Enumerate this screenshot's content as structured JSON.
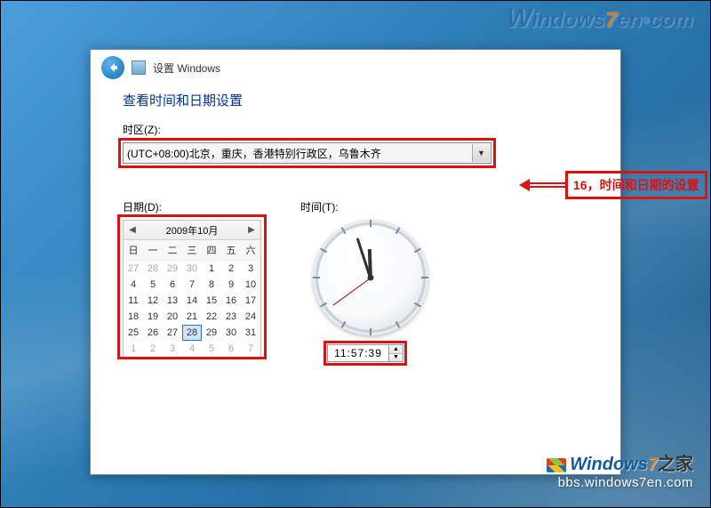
{
  "top_logo": {
    "prefix": "W",
    "text": "indows",
    "seven": "7",
    "suffix": "en",
    "tld": "com"
  },
  "bottom_logo": {
    "prefix": "W",
    "text": "indows",
    "seven": "7",
    "cn": "之家",
    "url": "bbs.windows7en.com"
  },
  "dialog": {
    "title": "设置 Windows",
    "heading": "查看时间和日期设置",
    "timezone_label": "时区(Z):",
    "timezone_value": "(UTC+08:00)北京，重庆，香港特别行政区，乌鲁木齐",
    "date_label": "日期(D):",
    "time_label": "时间(T):"
  },
  "calendar": {
    "month": "2009年10月",
    "dow": [
      "日",
      "一",
      "二",
      "三",
      "四",
      "五",
      "六"
    ],
    "days": [
      {
        "n": "27",
        "dim": true
      },
      {
        "n": "28",
        "dim": true
      },
      {
        "n": "29",
        "dim": true
      },
      {
        "n": "30",
        "dim": true
      },
      {
        "n": "1"
      },
      {
        "n": "2"
      },
      {
        "n": "3"
      },
      {
        "n": "4"
      },
      {
        "n": "5"
      },
      {
        "n": "6"
      },
      {
        "n": "7"
      },
      {
        "n": "8"
      },
      {
        "n": "9"
      },
      {
        "n": "10"
      },
      {
        "n": "11"
      },
      {
        "n": "12"
      },
      {
        "n": "13"
      },
      {
        "n": "14"
      },
      {
        "n": "15"
      },
      {
        "n": "16"
      },
      {
        "n": "17"
      },
      {
        "n": "18"
      },
      {
        "n": "19"
      },
      {
        "n": "20"
      },
      {
        "n": "21"
      },
      {
        "n": "22"
      },
      {
        "n": "23"
      },
      {
        "n": "24"
      },
      {
        "n": "25"
      },
      {
        "n": "26"
      },
      {
        "n": "27"
      },
      {
        "n": "28",
        "sel": true
      },
      {
        "n": "29"
      },
      {
        "n": "30"
      },
      {
        "n": "31"
      },
      {
        "n": "1",
        "dim": true
      },
      {
        "n": "2",
        "dim": true
      },
      {
        "n": "3",
        "dim": true
      },
      {
        "n": "4",
        "dim": true
      },
      {
        "n": "5",
        "dim": true
      },
      {
        "n": "6",
        "dim": true
      },
      {
        "n": "7",
        "dim": true
      }
    ]
  },
  "time": {
    "value": "11:57:39"
  },
  "annotation": {
    "text": "16，时间和日期的设置"
  }
}
